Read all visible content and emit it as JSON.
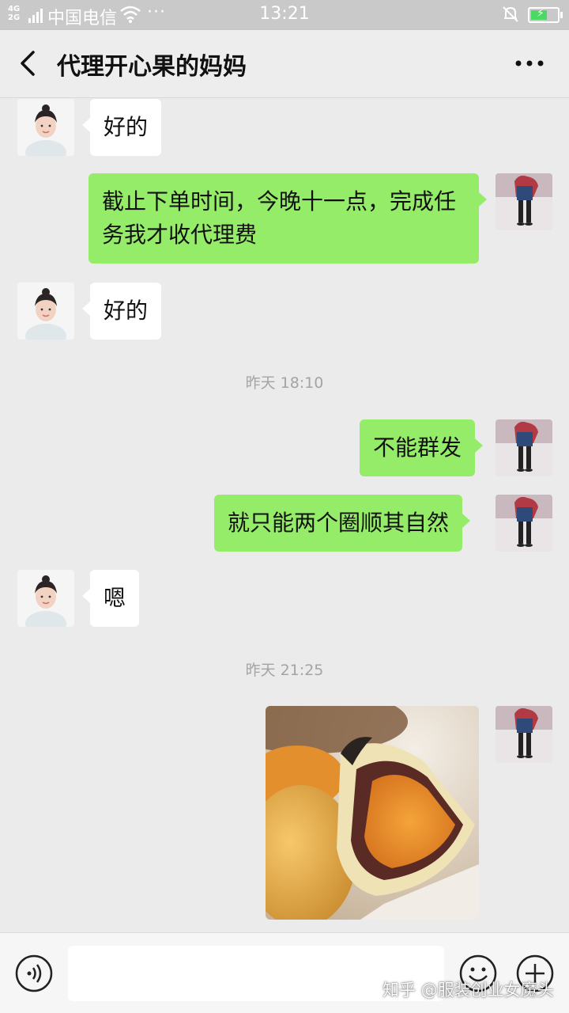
{
  "status_bar": {
    "network": "4G\n2G",
    "carrier": "中国电信",
    "more": "···",
    "time": "13:21"
  },
  "header": {
    "title": "代理开心果的妈妈"
  },
  "messages": [
    {
      "side": "left",
      "text": "好的"
    },
    {
      "side": "right",
      "text": "截止下单时间，今晚十一点，完成任务我才收代理费"
    },
    {
      "side": "left",
      "text": "好的"
    },
    {
      "timestamp": "昨天 18:10"
    },
    {
      "side": "right",
      "text": "不能群发"
    },
    {
      "side": "right",
      "text": "就只能两个圈顺其自然"
    },
    {
      "side": "left",
      "text": "嗯"
    },
    {
      "timestamp": "昨天 21:25"
    },
    {
      "side": "right",
      "image": "mooncake-photo"
    }
  ],
  "input": {
    "value": "",
    "placeholder": ""
  },
  "watermark": "知乎 @服装创业女魔头",
  "colors": {
    "chat_background": "#ebebeb",
    "sent_bubble": "#95ec69",
    "received_bubble": "#ffffff",
    "status_bar": "#c9c9c9"
  }
}
